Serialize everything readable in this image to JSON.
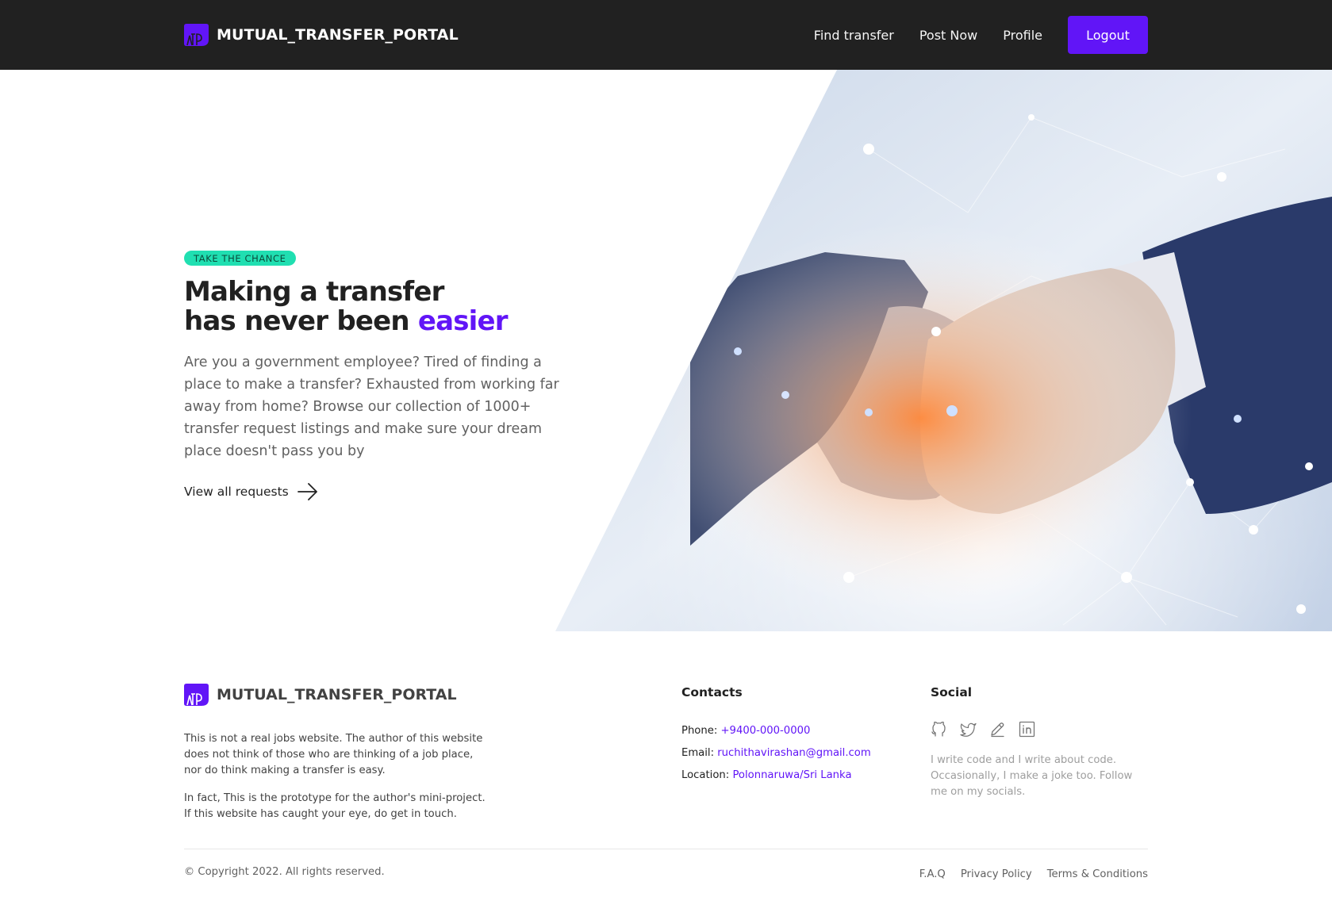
{
  "brand": {
    "name": "MUTUAL_TRANSFER_PORTAL",
    "logo_icon": "mtp-logo-icon",
    "accent_color": "#6115f7"
  },
  "navbar": {
    "links": [
      "Find transfer",
      "Post Now",
      "Profile"
    ],
    "logout_label": "Logout"
  },
  "hero": {
    "badge": "TAKE THE CHANCE",
    "title_line1": "Making a transfer",
    "title_line2": "has never been",
    "title_accent": "easier",
    "description": "Are you a government employee? Tired of finding a place to make a transfer? Exhausted from working far away from home? Browse our collection of 1000+ transfer request listings and make sure your dream place doesn't pass you by",
    "cta_label": "View all requests",
    "cta_icon": "arrow-right-icon",
    "image": "handshake-network-image"
  },
  "footer": {
    "about": [
      "This is not a real jobs website. The author of this website does not think of those who are thinking of a job place, nor do think making a transfer is easy.",
      "In fact, This is the prototype for the author's mini-project. If this website has caught your eye, do get in touch."
    ],
    "contacts": {
      "title": "Contacts",
      "phone_label": "Phone:",
      "phone": "+9400-000-0000",
      "email_label": "Email:",
      "email": "ruchithavirashan@gmail.com",
      "location_label": "Location:",
      "location": "Polonnaruwa/Sri Lanka"
    },
    "social": {
      "title": "Social",
      "icons": [
        "github-icon",
        "twitter-icon",
        "pencil-icon",
        "linkedin-icon"
      ],
      "text": "I write code and I write about code. Occasionally, I make a joke too. Follow me on my socials."
    },
    "copyright": "© Copyright 2022. All rights reserved.",
    "legal_links": [
      "F.A.Q",
      "Privacy Policy",
      "Terms & Conditions"
    ]
  }
}
